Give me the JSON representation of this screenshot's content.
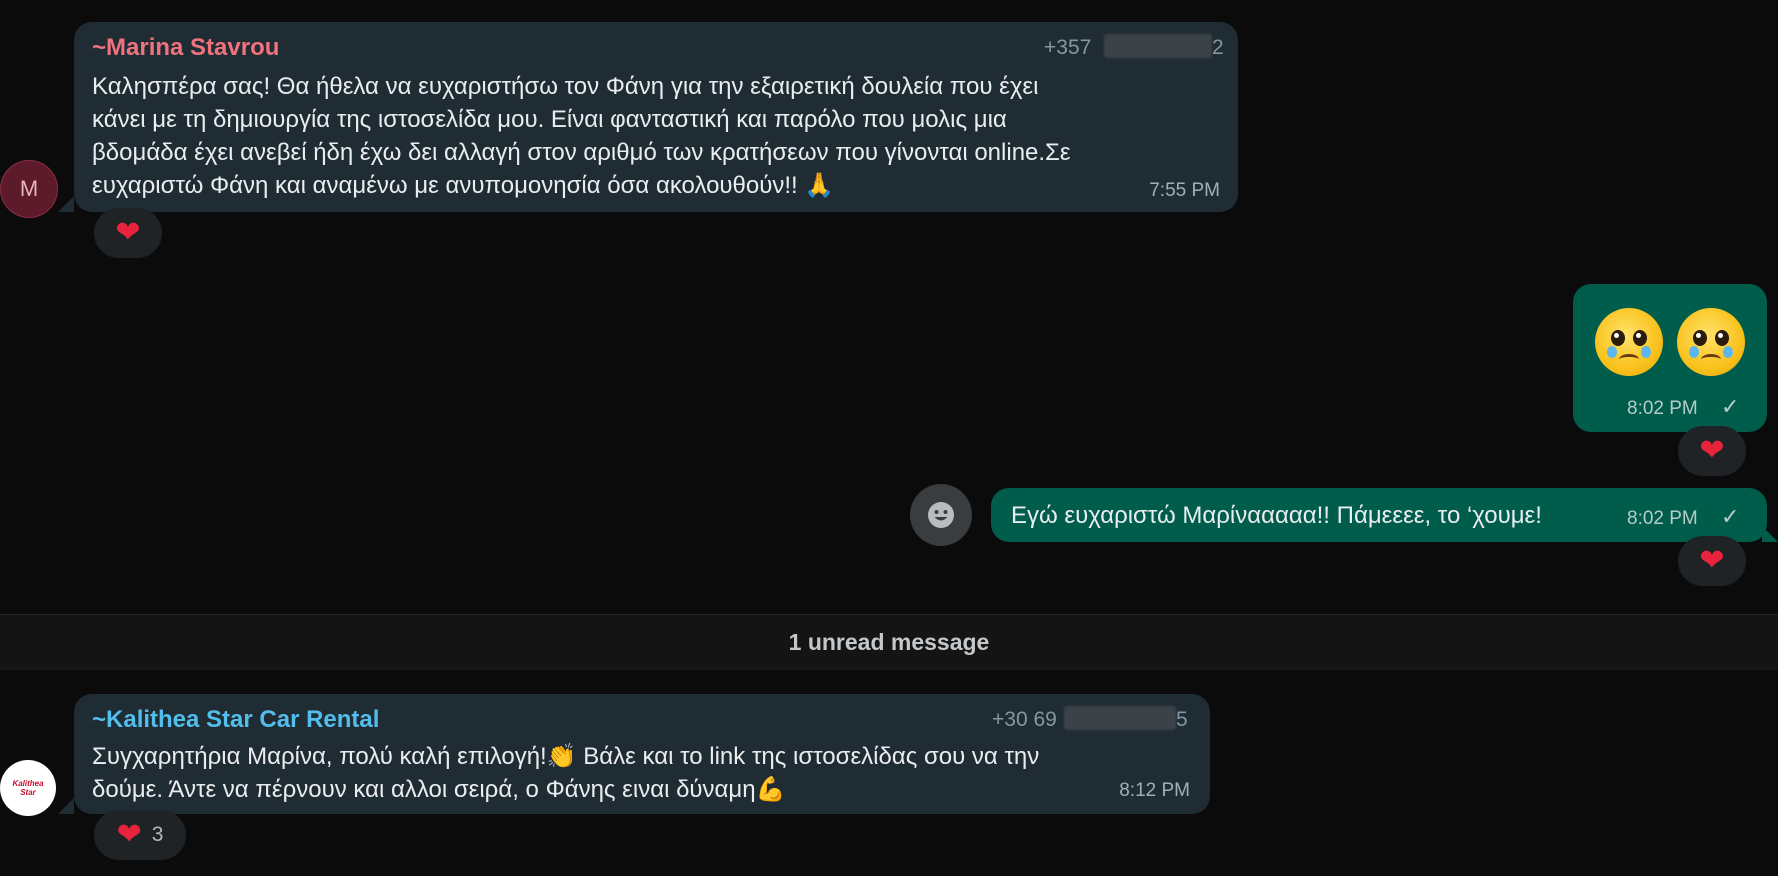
{
  "messages": {
    "marina": {
      "sender": "~Marina Stavrou",
      "phone_prefix": "+357",
      "phone_suffix": "2",
      "avatar_letter": "M",
      "lines": [
        "Καλησπέρα σας! Θα ήθελα να ευχαριστήσω τον Φάνη για την εξαιρετική δουλεία που έχει",
        "κάνει με τη δημιουργία της ιστοσελίδα μου. Είναι φανταστική και παρόλο που μολις μια",
        "βδομάδα έχει ανεβεί ήδη έχω δει αλλαγή στον αριθμό των κρατήσεων που γίνονται online.Σε",
        "ευχαριστώ Φάνη και αναμένω με ανυπομονησία όσα ακολουθούν!! 🙏"
      ],
      "time": "7:55 PM",
      "reaction": "❤"
    },
    "out_emoji": {
      "emojis": [
        "pleading-face",
        "pleading-face"
      ],
      "time": "8:02 PM",
      "status": "✓",
      "reaction": "❤"
    },
    "out_text": {
      "text": "Εγώ ευχαριστώ Μαρίνααααα!! Πάμεεεε, το ‘χουμε!",
      "time": "8:02 PM",
      "status": "✓",
      "reaction": "❤"
    },
    "kalithea": {
      "sender": "~Kalithea Star Car Rental",
      "phone_prefix": "+30 69",
      "phone_suffix": "5",
      "avatar_logo_text": "Kalithea Star",
      "lines": [
        "Συγχαρητήρια Μαρίνα, πολύ καλή επιλογή!👏 Βάλε και το link της ιστοσελίδας σου να την",
        "δούμε. Άντε να πέρνουν και αλλοι σειρά, ο Φάνης ειναι δύναμη💪"
      ],
      "time": "8:12 PM",
      "reaction": "❤",
      "reaction_count": "3"
    }
  },
  "divider": {
    "label": "1 unread message"
  },
  "colors": {
    "incoming_bubble": "#202c33",
    "outgoing_bubble": "#005c4b",
    "marina_name": "#f0727d",
    "kalithea_name": "#53bdeb",
    "heart": "#e8243c"
  }
}
